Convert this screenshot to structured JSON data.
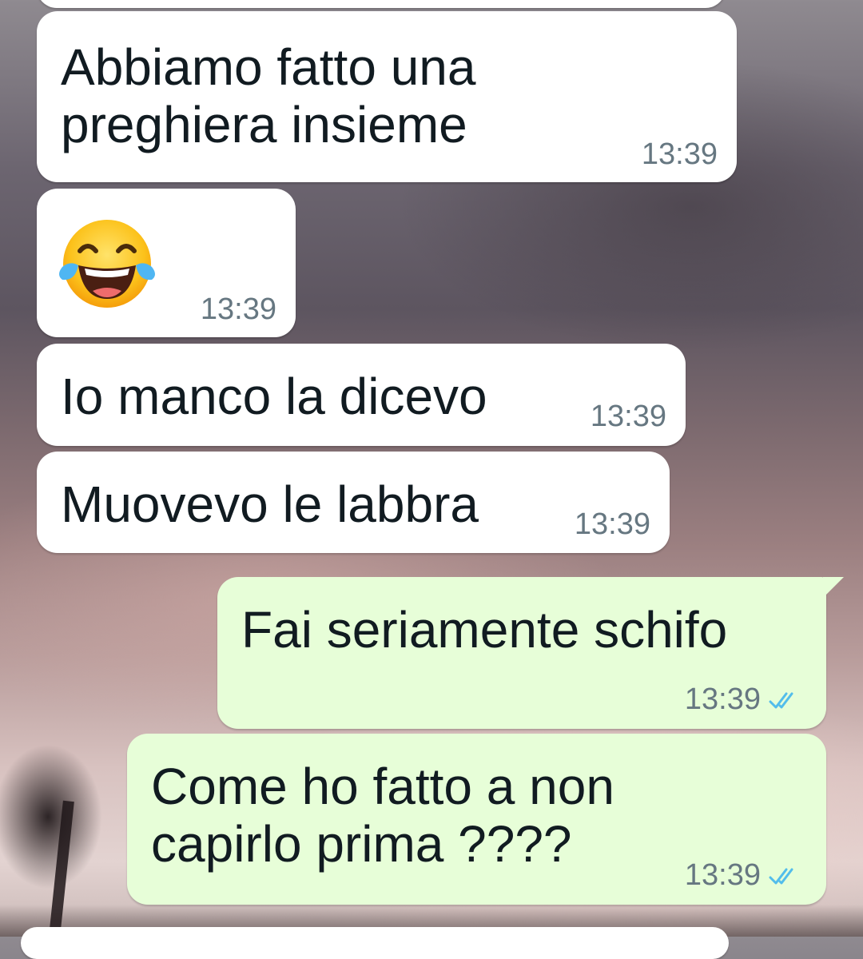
{
  "background": {
    "description_icon": "sunset-palm-wallpaper"
  },
  "messages": [
    {
      "direction": "in",
      "text": "Abbiamo fatto una\npreghiera insieme",
      "time": "13:39"
    },
    {
      "direction": "in",
      "emoji": "face-with-tears-of-joy-icon",
      "time": "13:39"
    },
    {
      "direction": "in",
      "text": "Io manco la dicevo",
      "time": "13:39"
    },
    {
      "direction": "in",
      "text": "Muovevo le labbra",
      "time": "13:39"
    },
    {
      "direction": "out",
      "text": "Fai seriamente schifo",
      "time": "13:39",
      "status": "read"
    },
    {
      "direction": "out",
      "text": "Come ho fatto a non\ncapirlo prima ????",
      "time": "13:39",
      "status": "read"
    }
  ],
  "colors": {
    "incoming_bubble": "#ffffff",
    "outgoing_bubble": "#e7fed8",
    "read_ticks": "#53bdeb",
    "timestamp": "#667781"
  }
}
